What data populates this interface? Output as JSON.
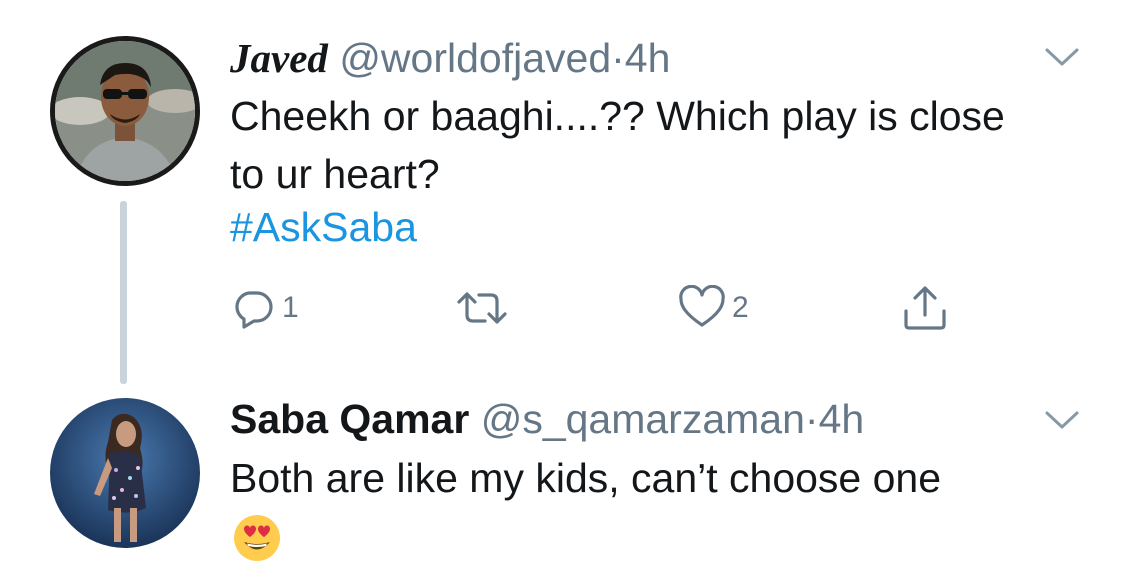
{
  "tweets": [
    {
      "name": "Javed",
      "handle": "@worldofjaved",
      "separator": "·",
      "time": "4h",
      "text": "Cheekh or baaghi....?? Which play is close to ur heart?",
      "hashtag": "#AskSaba",
      "actions": {
        "reply_count": "1",
        "like_count": "2"
      },
      "avatar_icon": "profile-photo-man-sunglasses"
    },
    {
      "name": "Saba Qamar",
      "handle": "@s_qamarzaman",
      "separator": "·",
      "time": "4h",
      "text": "Both are like my kids, can’t choose one",
      "emoji": "smiling-face-with-heart-eyes",
      "avatar_icon": "profile-photo-woman-sequin-dress"
    }
  ],
  "colors": {
    "hashtag": "#1b95e0",
    "secondary_text": "#657786",
    "thread_line": "#c9d3dc",
    "primary_text": "#14171a"
  }
}
